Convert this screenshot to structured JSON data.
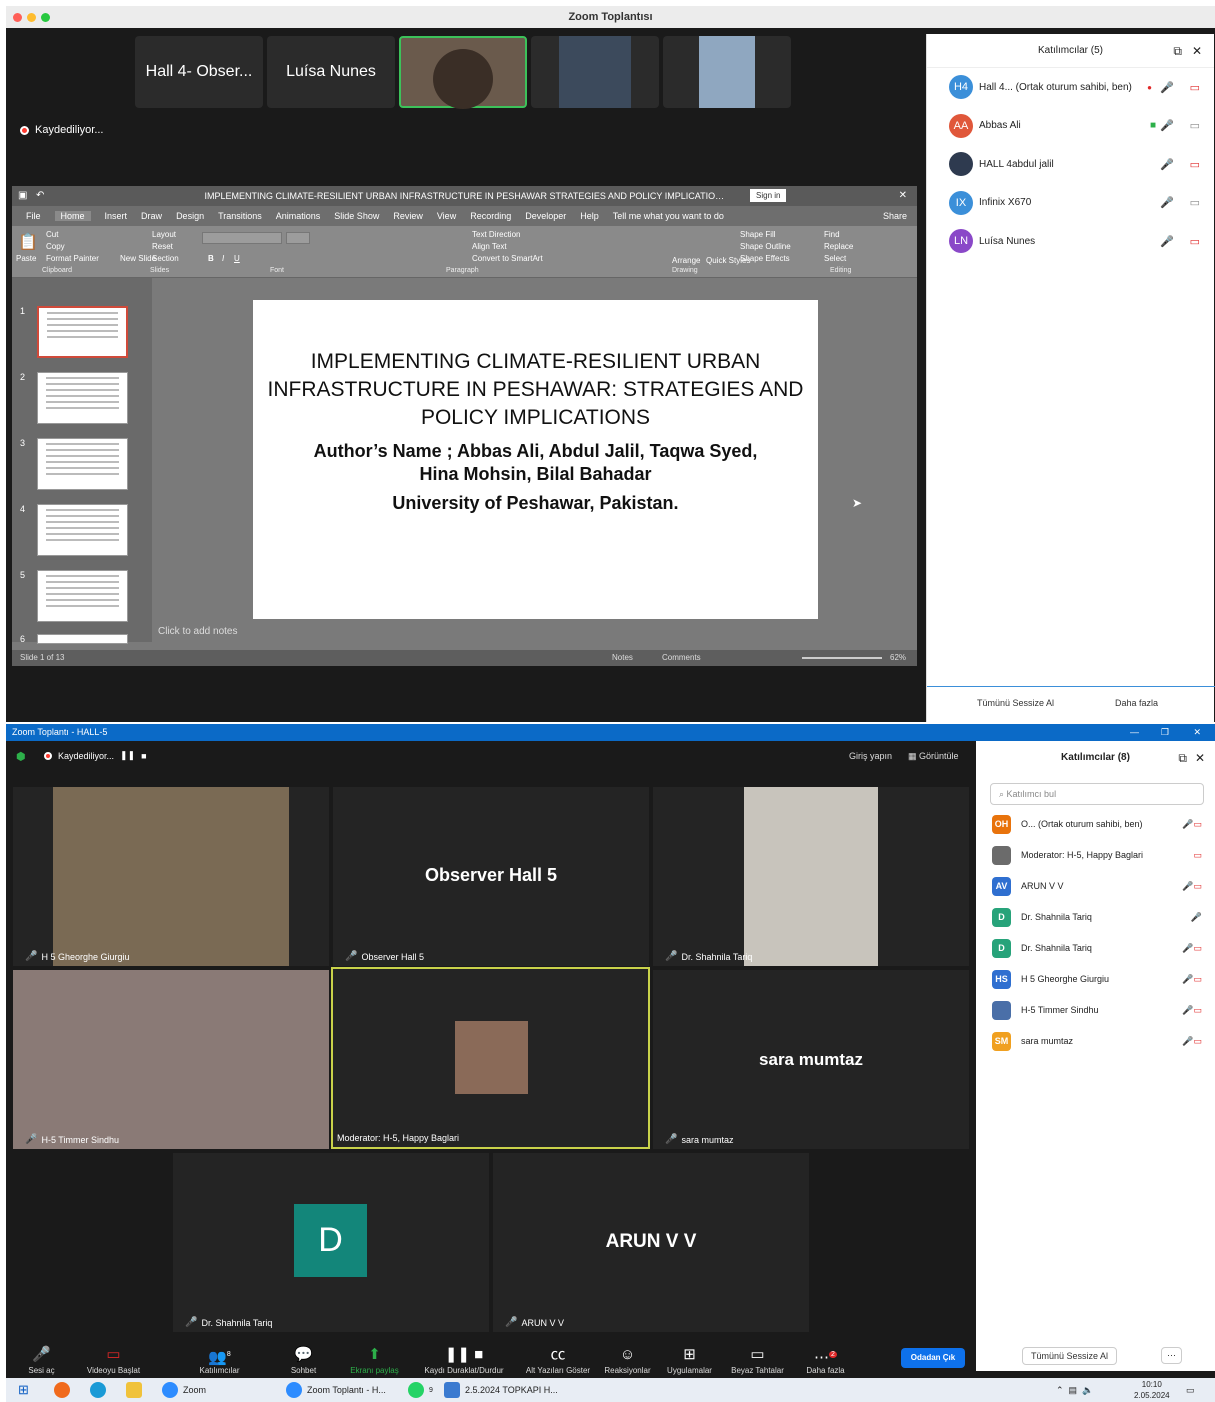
{
  "top": {
    "window_title": "Zoom Toplantısı",
    "tiles": [
      "Hall 4- Obser...",
      "Luísa Nunes"
    ],
    "recording": "Kaydediliyor...",
    "ppt": {
      "title": "IMPLEMENTING CLIMATE-RESILIENT URBAN INFRASTRUCTURE IN PESHAWAR STRATEGIES AND POLICY IMPLICATIONS - PowerPoint",
      "sign_in": "Sign in",
      "share": "Share",
      "tabs": [
        "File",
        "Home",
        "Insert",
        "Draw",
        "Design",
        "Transitions",
        "Animations",
        "Slide Show",
        "Review",
        "View",
        "Recording",
        "Developer",
        "Help",
        "Tell me what you want to do"
      ],
      "groups": [
        "Clipboard",
        "Slides",
        "Font",
        "Paragraph",
        "Drawing",
        "Editing"
      ],
      "ribbon_items": [
        "Paste",
        "Cut",
        "Copy",
        "Format Painter",
        "New Slide",
        "Layout",
        "Reset",
        "Section",
        "Text Direction",
        "Align Text",
        "Convert to SmartArt",
        "Arrange",
        "Quick Styles",
        "Shape Fill",
        "Shape Outline",
        "Shape Effects",
        "Find",
        "Replace",
        "Select"
      ],
      "slide_numbers": [
        "1",
        "2",
        "3",
        "4",
        "5",
        "6"
      ],
      "slide": {
        "title": "IMPLEMENTING CLIMATE-RESILIENT URBAN INFRASTRUCTURE IN PESHAWAR: STRATEGIES AND POLICY IMPLICATIONS",
        "authors": "Author’s Name ; Abbas Ali, Abdul Jalil, Taqwa Syed, Hina Mohsin, Bilal Bahadar",
        "university": "University of Peshawar, Pakistan."
      },
      "notes_placeholder": "Click to add notes",
      "status": "Slide 1 of 13",
      "notes_btn": "Notes",
      "comments_btn": "Comments",
      "zoom": "62%"
    },
    "participants": {
      "header": "Katılımcılar (5)",
      "list": [
        {
          "initials": "H4",
          "name": "Hall 4... (Ortak oturum sahibi, ben)",
          "color": "#3b8fd9"
        },
        {
          "initials": "AA",
          "name": "Abbas Ali",
          "color": "#e0573a"
        },
        {
          "initials": "",
          "name": "HALL 4abdul jalil",
          "color": "#2e3a4f"
        },
        {
          "initials": "IX",
          "name": "Infinix X670",
          "color": "#3b8fd9"
        },
        {
          "initials": "LN",
          "name": "Luísa Nunes",
          "color": "#8a48c8"
        }
      ],
      "mute_all": "Tümünü Sessize Al",
      "more": "Daha fazla"
    }
  },
  "bottom": {
    "window_title": "Zoom Toplantı - HALL-5",
    "recording": "Kaydediliyor...",
    "sign_in": "Giriş yapın",
    "view": "Görüntüle",
    "tiles": [
      {
        "name": "H 5 Gheorghe Giurgiu",
        "big": ""
      },
      {
        "name": "Observer Hall 5",
        "big": "Observer Hall 5"
      },
      {
        "name": "Dr. Shahnila Tariq",
        "big": ""
      },
      {
        "name": "H-5 Timmer Sindhu",
        "big": ""
      },
      {
        "name": "Moderator: H-5, Happy Baglari",
        "big": ""
      },
      {
        "name": "sara mumtaz",
        "big": "sara mumtaz"
      },
      {
        "name": "Dr. Shahnila Tariq",
        "big": "D"
      },
      {
        "name": "ARUN V V",
        "big": "ARUN V V"
      }
    ],
    "participants": {
      "header": "Katılımcılar (8)",
      "search": "Katılımcı bul",
      "list": [
        {
          "initials": "OH",
          "name": "O... (Ortak oturum sahibi, ben)",
          "color": "#e8730c"
        },
        {
          "initials": "",
          "name": "Moderator: H-5, Happy Baglari",
          "color": "#6b6b6b"
        },
        {
          "initials": "AV",
          "name": "ARUN V V",
          "color": "#2f6fd0"
        },
        {
          "initials": "D",
          "name": "Dr. Shahnila Tariq",
          "color": "#27a37a"
        },
        {
          "initials": "D",
          "name": "Dr. Shahnila Tariq",
          "color": "#27a37a"
        },
        {
          "initials": "HS",
          "name": "H 5 Gheorghe Giurgiu",
          "color": "#2f6fd0"
        },
        {
          "initials": "",
          "name": "H-5 Timmer Sindhu",
          "color": "#4a6fa8"
        },
        {
          "initials": "SM",
          "name": "sara mumtaz",
          "color": "#f0a020"
        }
      ],
      "mute_all": "Tümünü Sessize Al"
    },
    "controls": [
      "Sesi aç",
      "Videoyu Başlat",
      "Katılımcılar",
      "Sohbet",
      "Ekranı paylaş",
      "Kaydı Duraklat/Durdur",
      "Alt Yazıları Göster",
      "Reaksiyonlar",
      "Uygulamalar",
      "Beyaz Tahtalar",
      "Daha fazla"
    ],
    "participants_count": "8",
    "more_badge": "2",
    "leave": "Odadan Çık"
  },
  "taskbar": {
    "items": [
      "Zoom",
      "Zoom Toplantı - H...",
      "2.5.2024 TOPKAPI H..."
    ],
    "whatsapp_badge": "9",
    "time": "10:10",
    "date": "2.05.2024"
  }
}
